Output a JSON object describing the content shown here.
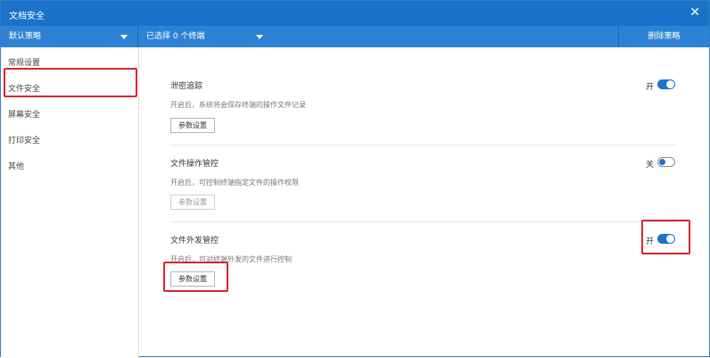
{
  "window": {
    "title": "文档安全",
    "close_glyph": "✕"
  },
  "toolbar": {
    "strategy_value": "默认策略",
    "terminal_value": "已选择 0 个终端",
    "delete_label": "删除策略"
  },
  "sidebar": {
    "items": [
      {
        "label": "常规设置",
        "selected": false
      },
      {
        "label": "文件安全",
        "selected": true
      },
      {
        "label": "屏幕安全",
        "selected": false
      },
      {
        "label": "打印安全",
        "selected": false
      },
      {
        "label": "其他",
        "selected": false
      }
    ]
  },
  "sections": [
    {
      "title": "泄密追踪",
      "description": "开启后，系统将会保存终端的操作文件记录",
      "button_label": "参数设置",
      "button_enabled": true,
      "toggle_state": "on",
      "toggle_label": "开"
    },
    {
      "title": "文件操作管控",
      "description": "开启后，可控制终端指定文件的操作权限",
      "button_label": "参数设置",
      "button_enabled": false,
      "toggle_state": "off",
      "toggle_label": "关"
    },
    {
      "title": "文件外发管控",
      "description": "开启后，可对终端外发的文件进行控制",
      "button_label": "参数设置",
      "button_enabled": true,
      "toggle_state": "on",
      "toggle_label": "开"
    }
  ],
  "colors": {
    "titlebar": "#1a73c9",
    "toolbar": "#2d82d4",
    "toggle_on": "#1a73c9",
    "highlight": "#d9262c"
  },
  "icons": {
    "close": "close-icon",
    "dropdown": "caret-down-icon"
  }
}
